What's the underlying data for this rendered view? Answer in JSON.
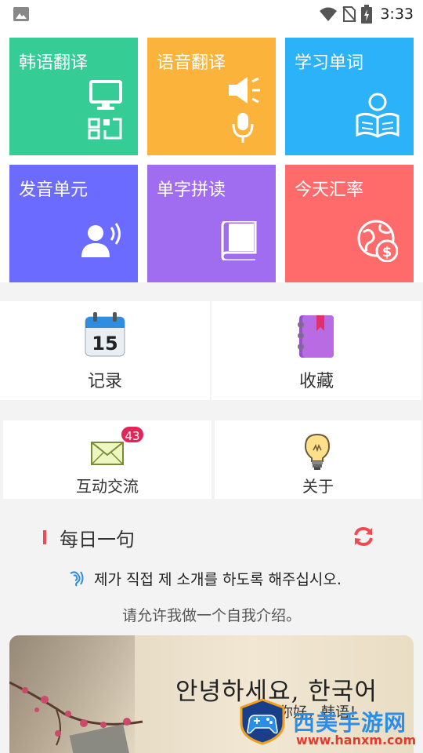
{
  "status_bar": {
    "time": "3:33",
    "icons": [
      "image-icon",
      "wifi-icon",
      "no-sim-icon",
      "battery-charging-icon"
    ]
  },
  "tiles": [
    {
      "label": "韩语翻译",
      "icon": "monitor-qr-icon",
      "color": "#36cc96"
    },
    {
      "label": "语音翻译",
      "icon": "speaker-mic-icon",
      "color": "#fbb33c"
    },
    {
      "label": "学习单词",
      "icon": "reader-book-icon",
      "color": "#2cb2f8"
    },
    {
      "label": "发音单元",
      "icon": "speaking-person-icon",
      "color": "#6b6bff"
    },
    {
      "label": "单字拼读",
      "icon": "book-icon",
      "color": "#a06cf0"
    },
    {
      "label": "今天汇率",
      "icon": "globe-dollar-icon",
      "color": "#ff6b6b"
    }
  ],
  "cards": {
    "record": {
      "label": "记录",
      "icon": "calendar-icon",
      "calendar_day": "15"
    },
    "favorite": {
      "label": "收藏",
      "icon": "notebook-icon"
    },
    "communication": {
      "label": "互动交流",
      "icon": "envelope-icon",
      "badge": "43"
    },
    "about": {
      "label": "关于",
      "icon": "lightbulb-icon"
    }
  },
  "daily": {
    "title": "每日一句",
    "korean": "제가 직접 제 소개를 하도록 해주십시오.",
    "chinese": "请允许我做一个自我介绍。"
  },
  "banner": {
    "greeting": "안녕하세요, 한국어",
    "greeting_sub": "你好，韩语！"
  },
  "watermark": {
    "text": "西美手游网",
    "url": "www.hanxm.com"
  }
}
